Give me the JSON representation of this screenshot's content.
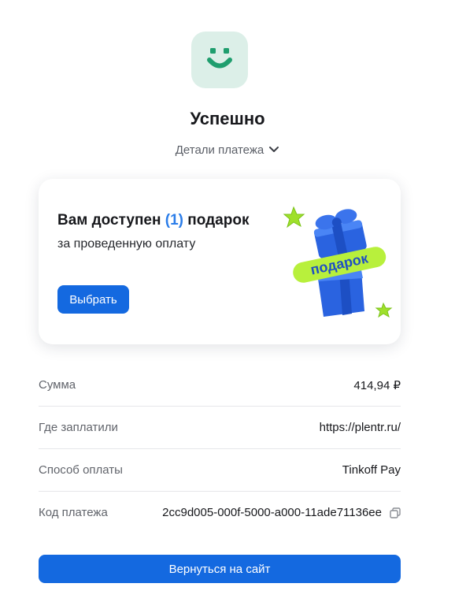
{
  "header": {
    "icon": "smile-icon",
    "title": "Успешно",
    "details_toggle": "Детали платежа"
  },
  "gift_card": {
    "title_prefix": "Вам доступен",
    "count": "(1)",
    "title_suffix": "подарок",
    "subtitle": "за проведенную оплату",
    "choose_label": "Выбрать",
    "badge_text": "подарок"
  },
  "details": [
    {
      "label": "Сумма",
      "value": "414,94 ₽"
    },
    {
      "label": "Где заплатили",
      "value": "https://plentr.ru/"
    },
    {
      "label": "Способ оплаты",
      "value": "Tinkoff Pay"
    },
    {
      "label": "Код платежа",
      "value": "2cc9d005-000f-5000-a000-11ade71136ee"
    }
  ],
  "back_label": "Вернуться на сайт",
  "colors": {
    "accent": "#1469e0",
    "success": "#1f9e6e",
    "success_bg": "#dcefe8",
    "count_highlight": "#2b7de9",
    "gift_blue": "#2a63e0",
    "gift_green": "#b8f03c"
  }
}
